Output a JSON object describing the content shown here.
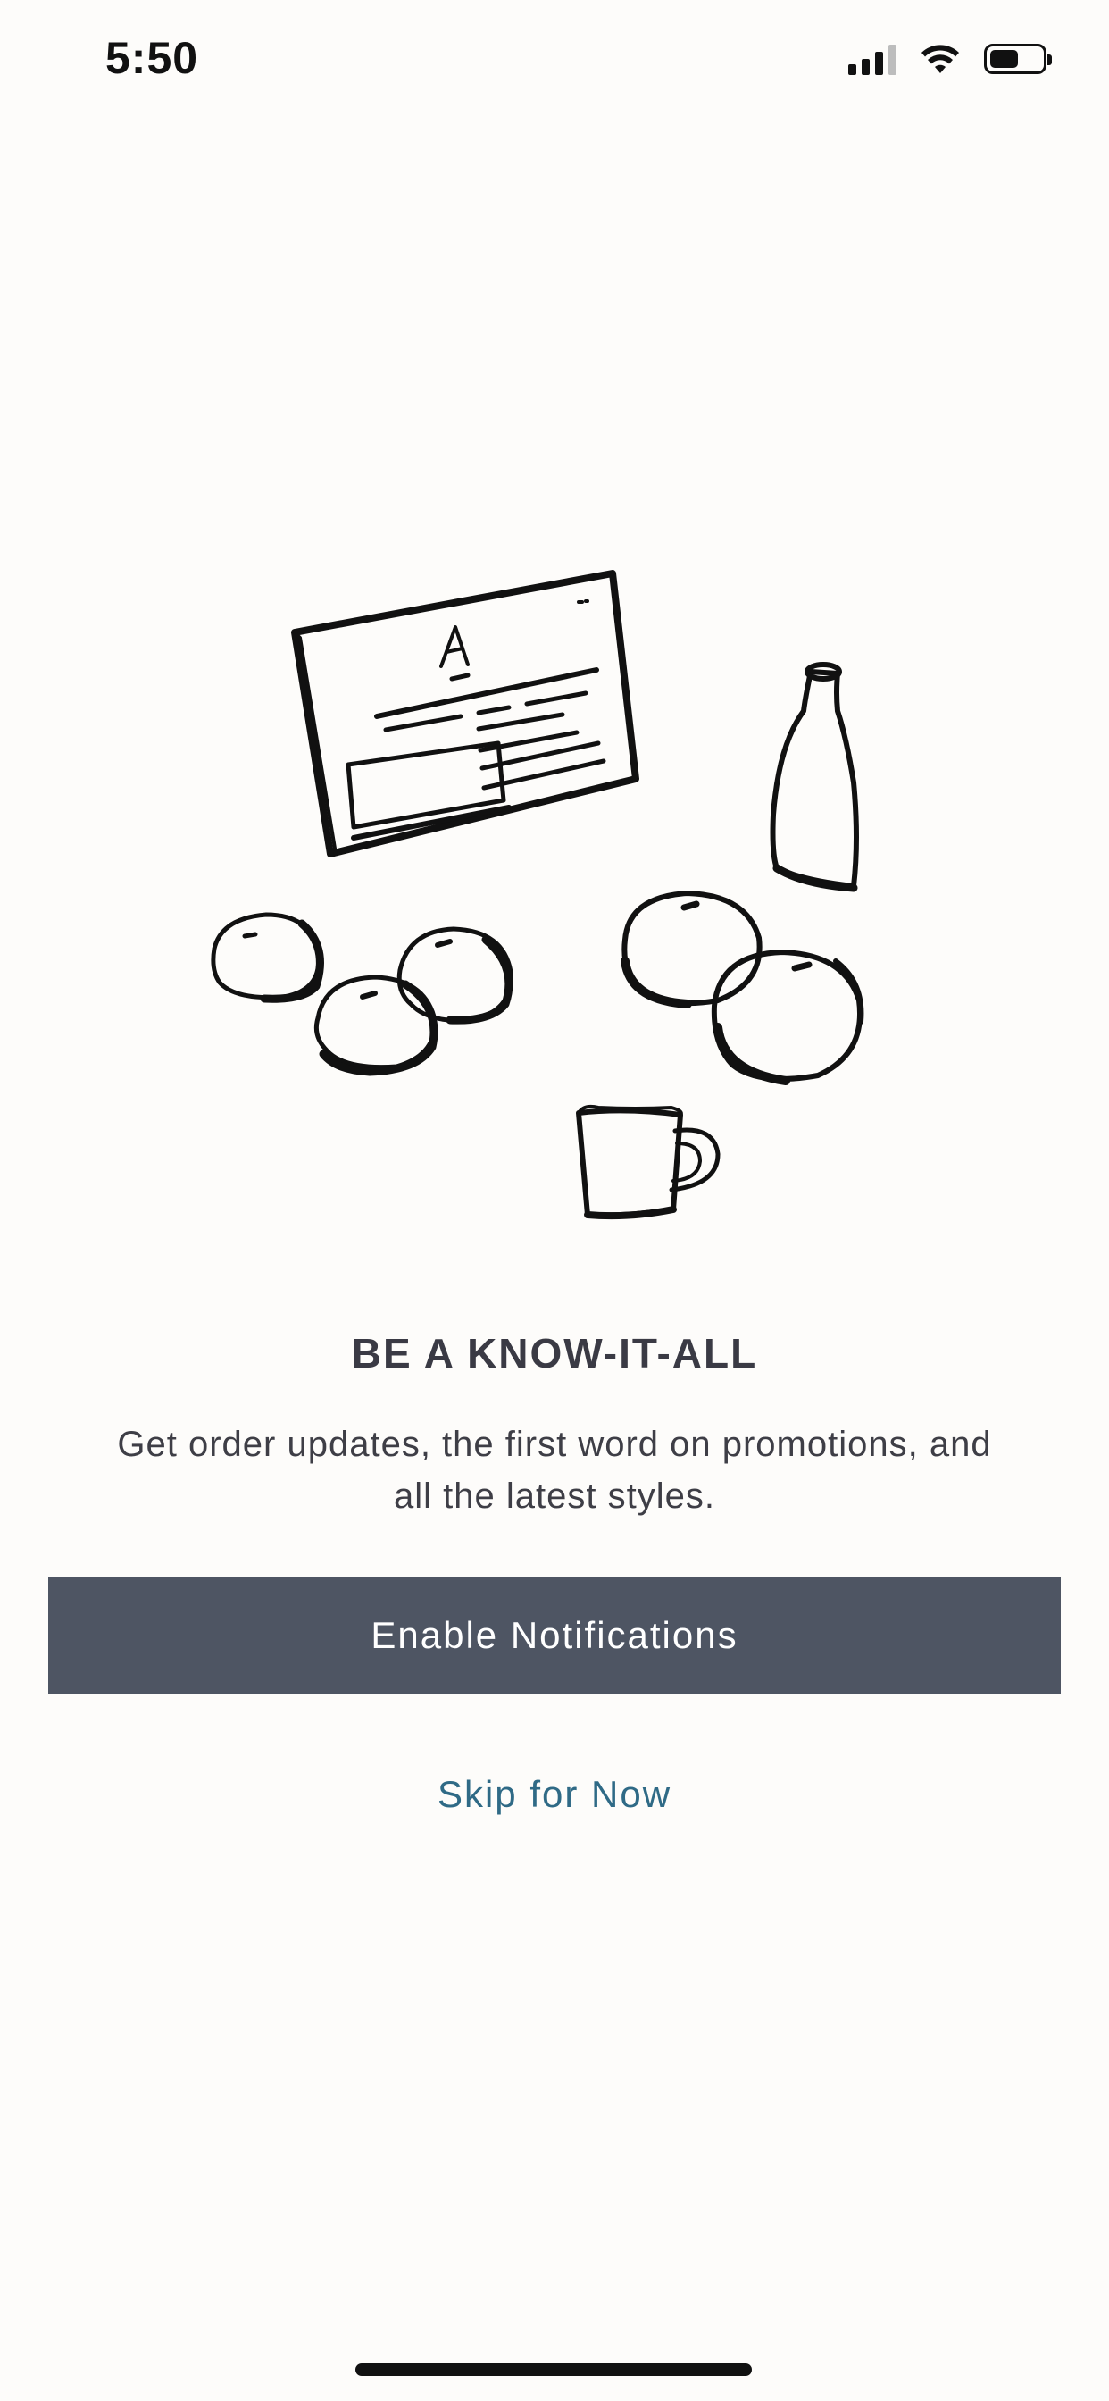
{
  "status_bar": {
    "time": "5:50",
    "icons": [
      "cellular-signal-icon",
      "wifi-icon",
      "battery-icon"
    ],
    "battery_level": 0.55
  },
  "illustration": {
    "icon": "still-life-illustration",
    "card_letter": "A"
  },
  "onboarding": {
    "title": "BE A KNOW-IT-ALL",
    "description_line1": "Get order updates, the first word on promotions, and",
    "description_line2": "all the latest styles.",
    "enable_button_label": "Enable Notifications",
    "skip_label": "Skip for Now"
  },
  "colors": {
    "background": "#FDFCFA",
    "button": "#4E5563",
    "link": "#2F6A86",
    "text": "#3A3A44"
  }
}
